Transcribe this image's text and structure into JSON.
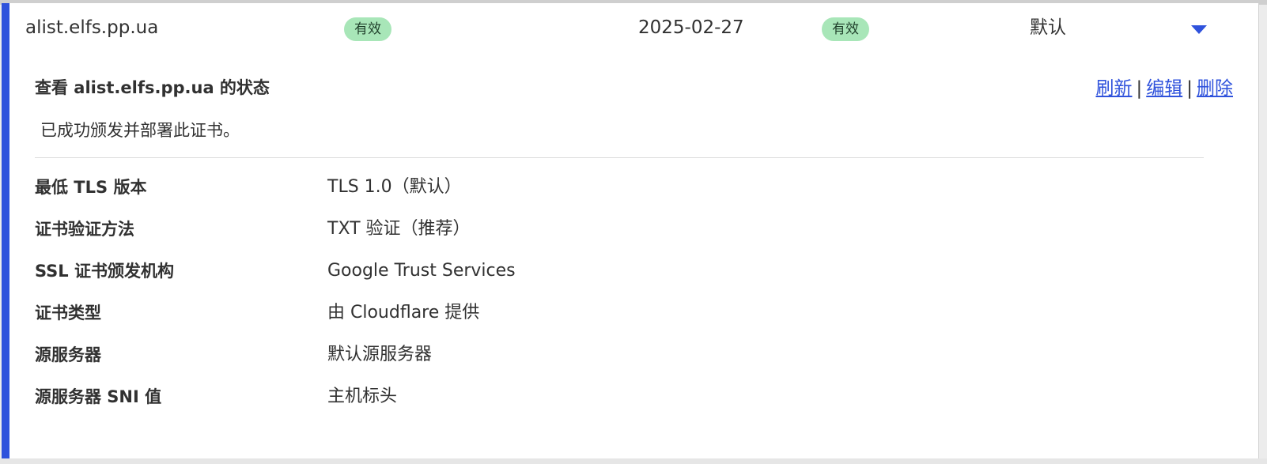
{
  "certificate": {
    "hostname": "alist.elfs.pp.ua",
    "status_badge": "有效",
    "expiry": "2025-02-27",
    "validation_badge": "有效",
    "mode": "默认"
  },
  "detail": {
    "title": "查看 alist.elfs.pp.ua 的状态",
    "actions": {
      "refresh": "刷新",
      "separator": "|",
      "edit": "编辑",
      "delete": "删除"
    },
    "status_message": "已成功颁发并部署此证书。",
    "properties": [
      {
        "label": "最低 TLS 版本",
        "value": "TLS 1.0（默认）"
      },
      {
        "label": "证书验证方法",
        "value": "TXT 验证（推荐）"
      },
      {
        "label": "SSL 证书颁发机构",
        "value": "Google Trust Services"
      },
      {
        "label": "证书类型",
        "value": "由 Cloudflare 提供"
      },
      {
        "label": "源服务器",
        "value": "默认源服务器"
      },
      {
        "label": "源服务器 SNI 值",
        "value": "主机标头"
      }
    ]
  },
  "colors": {
    "accent": "#2f52dc",
    "badge_bg": "#a8e6b8",
    "text": "#313131"
  },
  "icons": {
    "expand": "caret-down-icon"
  }
}
